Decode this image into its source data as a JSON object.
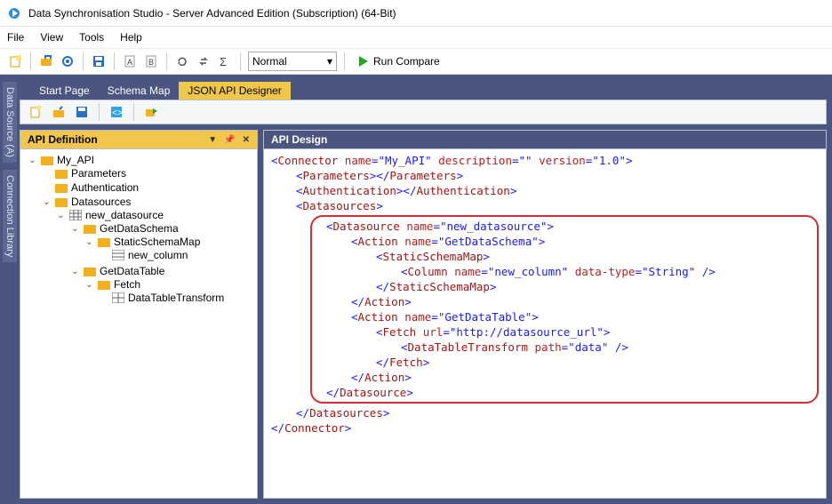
{
  "title": "Data Synchronisation Studio - Server Advanced Edition (Subscription) (64-Bit)",
  "menu": {
    "file": "File",
    "view": "View",
    "tools": "Tools",
    "help": "Help"
  },
  "toolbar1": {
    "mode_value": "Normal",
    "run_label": "Run Compare"
  },
  "doc_tabs": {
    "start": "Start Page",
    "schema": "Schema Map",
    "json": "JSON API Designer"
  },
  "side_tabs": {
    "dsa": "Data Source (A)",
    "cl": "Connection Library"
  },
  "api_def": {
    "title": "API Definition",
    "tree": {
      "root": "My_API",
      "params": "Parameters",
      "auth": "Authentication",
      "datasources": "Datasources",
      "new_ds": "new_datasource",
      "get_schema": "GetDataSchema",
      "static_map": "StaticSchemaMap",
      "new_col": "new_column",
      "get_table": "GetDataTable",
      "fetch": "Fetch",
      "dtt": "DataTableTransform"
    }
  },
  "api_design": {
    "title": "API Design",
    "xml": {
      "connector_name": "My_API",
      "connector_desc": "",
      "connector_ver": "1.0",
      "ds_name": "new_datasource",
      "action1": "GetDataSchema",
      "col_name": "new_column",
      "col_type": "String",
      "action2": "GetDataTable",
      "fetch_url": "http://datasource_url",
      "dtt_path": "data"
    }
  }
}
